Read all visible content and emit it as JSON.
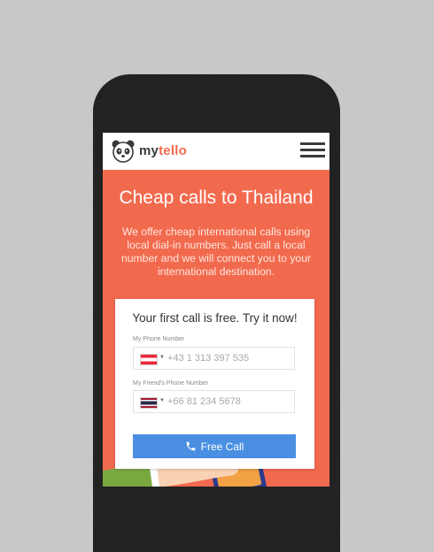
{
  "header": {
    "brand_part1": "my",
    "brand_part2": "tello",
    "logo_icon": "panda-logo-icon",
    "menu_icon": "hamburger-menu-icon"
  },
  "hero": {
    "title": "Cheap calls to Thailand",
    "description": "We offer cheap international calls using local dial-in numbers. Just call a local number and we will connect you to your international destination."
  },
  "form": {
    "title": "Your first call is free. Try it now!",
    "my_phone": {
      "label": "My Phone Number",
      "placeholder": "+43 1 313 397 535",
      "flag": "austria-flag-icon"
    },
    "friend_phone": {
      "label": "My Friend's Phone Number",
      "placeholder": "+66 81 234 5678",
      "flag": "thailand-flag-icon"
    },
    "button_label": "Free Call",
    "button_icon": "phone-icon"
  },
  "colors": {
    "accent": "#f26a4e",
    "button": "#4a8fe2",
    "phone_body": "#222222",
    "background": "#cacaca"
  }
}
